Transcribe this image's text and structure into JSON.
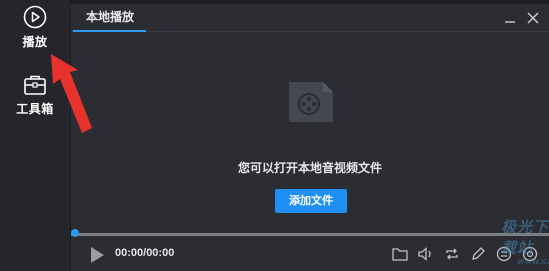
{
  "sidebar": {
    "items": [
      {
        "label": "播放",
        "icon": "play-circle-icon"
      },
      {
        "label": "工具箱",
        "icon": "toolbox-icon"
      }
    ]
  },
  "header": {
    "tab_label": "本地播放",
    "minimize_icon": "minimize-icon",
    "close_icon": "close-icon"
  },
  "empty_state": {
    "icon": "video-file-icon",
    "hint": "您可以打开本地音视频文件",
    "add_button": "添加文件"
  },
  "player": {
    "time": "00:00/00:00",
    "progress": 0,
    "icons": [
      "play-icon",
      "folder-icon",
      "volume-icon",
      "repeat-icon",
      "pen-icon",
      "shuffle-icon",
      "settings-icon"
    ]
  },
  "watermark": {
    "text": "极光下载站",
    "url": "www.xz7.com"
  },
  "colors": {
    "accent": "#1f8ff3",
    "panel": "#2b2d33",
    "sidebar": "#24262b",
    "arrow": "#e8322c"
  }
}
